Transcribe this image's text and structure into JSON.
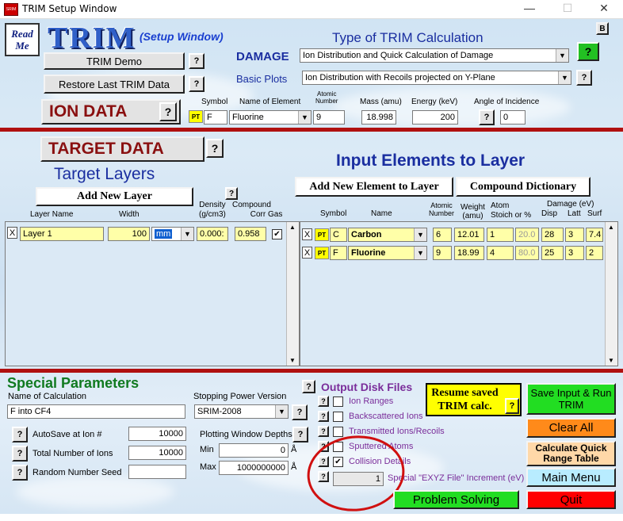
{
  "window": {
    "title": "TRIM Setup Window",
    "app_icon_label": "SRIM"
  },
  "header": {
    "read_me": "Read Me",
    "trim_logo": "TRIM",
    "setup_window": "(Setup Window)",
    "type_heading": "Type of TRIM Calculation",
    "b_label": "B",
    "damage_label": "DAMAGE",
    "damage_value": "Ion Distribution and Quick Calculation of Damage",
    "basic_plots_label": "Basic Plots",
    "basic_plots_value": "Ion Distribution with Recoils projected on Y-Plane",
    "trim_demo": "TRIM Demo",
    "restore_last": "Restore Last TRIM Data"
  },
  "ion": {
    "heading": "ION DATA",
    "symbol_h": "Symbol",
    "name_h": "Name of Element",
    "atomic_h1": "Atomic",
    "atomic_h2": "Number",
    "mass_h": "Mass (amu)",
    "energy_h": "Energy (keV)",
    "angle_h": "Angle of Incidence",
    "pt": "PT",
    "symbol": "F",
    "name": "Fluorine",
    "atomic_number": "9",
    "mass": "18.998",
    "energy": "200",
    "angle": "0"
  },
  "target": {
    "heading": "TARGET DATA",
    "layers_heading": "Target Layers",
    "add_layer": "Add New Layer",
    "density_h1": "Density",
    "density_h2": "(g/cm3)",
    "compound_h1": "Compound",
    "compound_h2": "Corr",
    "layer_name_h": "Layer Name",
    "width_h": "Width",
    "gas_h": "Gas",
    "layers": [
      {
        "name": "Layer 1",
        "width": "100",
        "unit": "mm",
        "density": "0.000:",
        "corr": "0.958",
        "gas": "✔"
      }
    ]
  },
  "elements": {
    "heading": "Input Elements to Layer",
    "add_element": "Add New Element to Layer",
    "compound_dict": "Compound Dictionary",
    "symbol_h": "Symbol",
    "name_h": "Name",
    "atomic_h1": "Atomic",
    "atomic_h2": "Number",
    "weight_h1": "Weight",
    "weight_h2": "(amu)",
    "atom_h1": "Atom",
    "atom_h2": "Stoich or %",
    "damage_h": "Damage (eV)",
    "disp_h": "Disp",
    "latt_h": "Latt",
    "surf_h": "Surf",
    "rows": [
      {
        "pt": "PT",
        "symbol": "C",
        "name": "Carbon",
        "atomic": "6",
        "weight": "12.01",
        "stoich": "1",
        "pct": "20.0",
        "disp": "28",
        "latt": "3",
        "surf": "7.4"
      },
      {
        "pt": "PT",
        "symbol": "F",
        "name": "Fluorine",
        "atomic": "9",
        "weight": "18.99",
        "stoich": "4",
        "pct": "80.0",
        "disp": "25",
        "latt": "3",
        "surf": "2"
      }
    ]
  },
  "special": {
    "heading": "Special Parameters",
    "name_calc_label": "Name of Calculation",
    "name_calc_value": "F into CF4",
    "stopping_label": "Stopping Power Version",
    "stopping_value": "SRIM-2008",
    "autosave_label": "AutoSave at Ion #",
    "autosave_value": "10000",
    "total_ions_label": "Total Number of Ions",
    "total_ions_value": "10000",
    "seed_label": "Random Number Seed",
    "seed_value": "",
    "plot_depths_label": "Plotting Window Depths",
    "min_label": "Min",
    "min_value": "0",
    "max_label": "Max",
    "max_value": "1000000000",
    "unit": "Å"
  },
  "output": {
    "heading": "Output Disk Files",
    "ion_ranges": "Ion Ranges",
    "backscattered": "Backscattered Ions",
    "transmitted": "Transmitted Ions/Recoils",
    "sputtered": "Sputtered Atoms",
    "collision": "Collision Details",
    "exyz_value": "1",
    "exyz_label": "Special \"EXYZ File\" Increment (eV)"
  },
  "actions": {
    "resume": "Resume saved TRIM calc.",
    "save_run": "Save Input & Run TRIM",
    "clear_all": "Clear All",
    "quick_range": "Calculate Quick Range Table",
    "main_menu": "Main Menu",
    "problem_solving": "Problem Solving",
    "quit": "Quit"
  },
  "q": "?",
  "x": "X",
  "dropdown": "▼"
}
